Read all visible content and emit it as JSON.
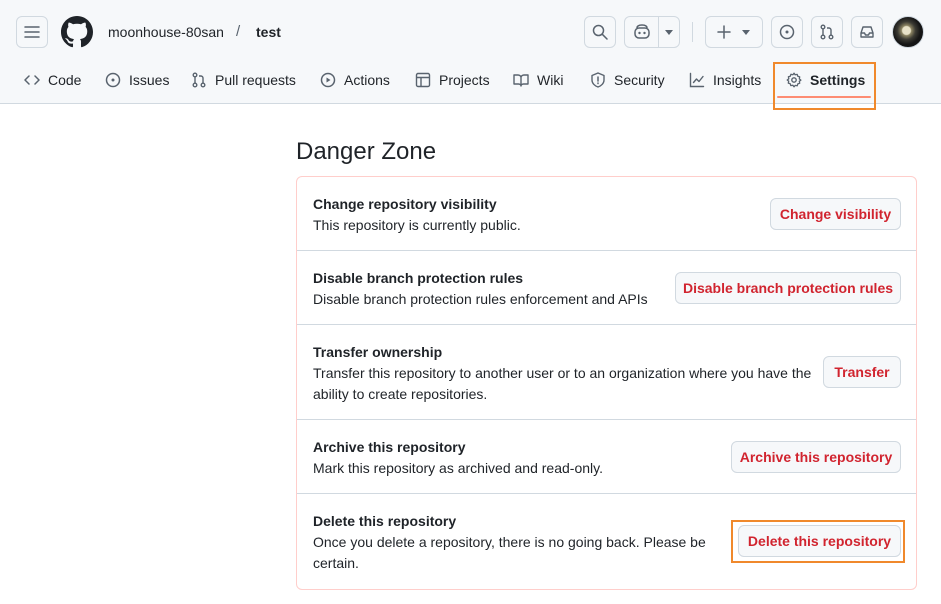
{
  "header": {
    "owner": "moonhouse-80san",
    "separator": "/",
    "repo": "test"
  },
  "icons": {
    "menu": "hamburger-icon",
    "logo": "github-logo-icon",
    "search": "search-icon",
    "copilot": "copilot-icon",
    "create": "plus-icon",
    "issues": "issue-opened-icon",
    "pull_requests": "git-pull-request-icon",
    "inbox": "inbox-icon"
  },
  "tabs": [
    {
      "label": "Code",
      "icon": "code-icon"
    },
    {
      "label": "Issues",
      "icon": "issue-opened-icon"
    },
    {
      "label": "Pull requests",
      "icon": "git-pull-request-icon"
    },
    {
      "label": "Actions",
      "icon": "play-icon"
    },
    {
      "label": "Projects",
      "icon": "table-icon"
    },
    {
      "label": "Wiki",
      "icon": "book-icon"
    },
    {
      "label": "Security",
      "icon": "shield-icon"
    },
    {
      "label": "Insights",
      "icon": "graph-icon"
    },
    {
      "label": "Settings",
      "icon": "gear-icon",
      "selected": true
    }
  ],
  "danger_zone": {
    "title": "Danger Zone",
    "rows": [
      {
        "title": "Change repository visibility",
        "description": "This repository is currently public.",
        "button": "Change visibility"
      },
      {
        "title": "Disable branch protection rules",
        "description": "Disable branch protection rules enforcement and APIs",
        "button": "Disable branch protection rules"
      },
      {
        "title": "Transfer ownership",
        "description": "Transfer this repository to another user or to an organization where you have the ability to create repositories.",
        "button": "Transfer"
      },
      {
        "title": "Archive this repository",
        "description": "Mark this repository as archived and read-only.",
        "button": "Archive this repository"
      },
      {
        "title": "Delete this repository",
        "description": "Once you delete a repository, there is no going back. Please be certain.",
        "button": "Delete this repository"
      }
    ]
  },
  "colors": {
    "danger_text": "#d1242f",
    "danger_border": "#ffcecb",
    "highlight": "#f0892c",
    "tab_underline": "#fd8c73"
  }
}
